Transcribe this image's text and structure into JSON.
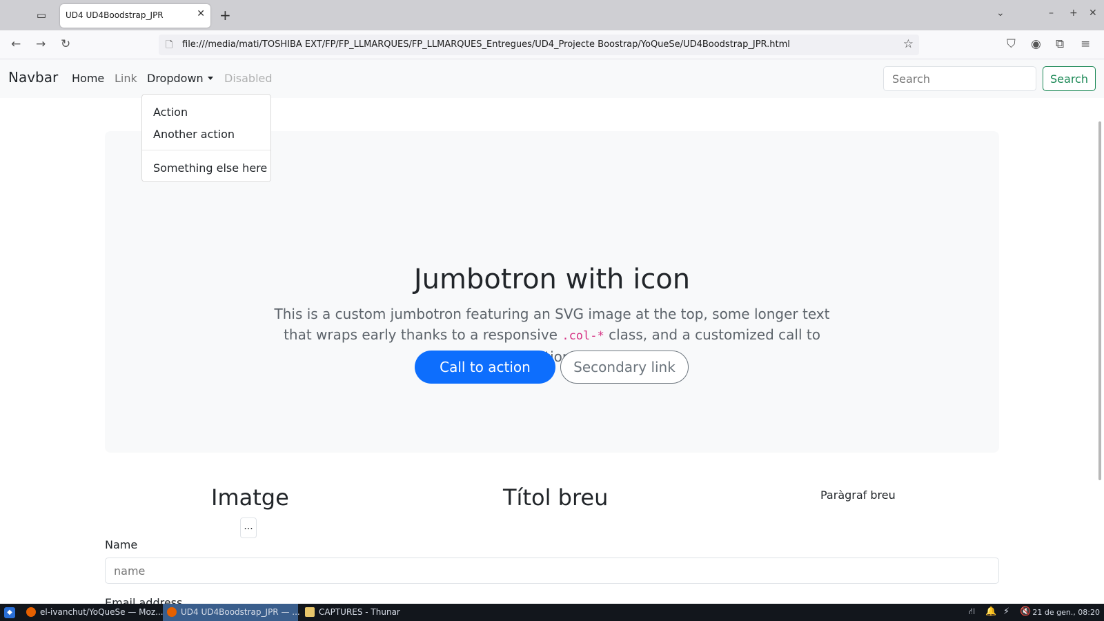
{
  "browser": {
    "tab_title": "UD4 UD4Boodstrap_JPR",
    "url": "file:///media/mati/TOSHIBA EXT/FP/FP_LLMARQUES/FP_LLMARQUES_Entregues/UD4_Projecte Boostrap/YoQueSe/UD4Boodstrap_JPR.html",
    "icons": [
      "tab-list-icon",
      "close-icon",
      "plus-icon",
      "chevron-down-icon",
      "minimize-icon",
      "maximize-icon",
      "close-window-icon",
      "back-icon",
      "forward-icon",
      "reload-icon",
      "document-icon",
      "star-icon",
      "pocket-icon",
      "account-icon",
      "extensions-icon",
      "menu-icon"
    ]
  },
  "navbar": {
    "brand": "Navbar",
    "links": [
      "Home",
      "Link",
      "Dropdown",
      "Disabled"
    ],
    "search_placeholder": "Search",
    "search_button": "Search"
  },
  "dropdown": {
    "items": [
      "Action",
      "Another action",
      "Something else here"
    ]
  },
  "jumbotron": {
    "title": "Jumbotron with icon",
    "text_before": "This is a custom jumbotron featuring an SVG image at the top, some longer text that wraps early thanks to a responsive ",
    "code": ".col-*",
    "text_after": " class, and a customized call to action.",
    "primary_button": "Call to action",
    "secondary_button": "Secondary link"
  },
  "columns": {
    "heading_1": "Imatge",
    "heading_2": "Títol breu",
    "paragraph": "Paràgraf breu",
    "ellipsis": "..."
  },
  "form": {
    "name_label": "Name",
    "name_placeholder": "name",
    "email_label": "Email address"
  },
  "taskbar": {
    "tasks": [
      "el-ivanchut/YoQueSe — Moz...",
      "UD4 UD4Boodstrap_JPR — ...",
      "CAPTURES - Thunar"
    ],
    "clock": "21 de gen., 08:20"
  }
}
